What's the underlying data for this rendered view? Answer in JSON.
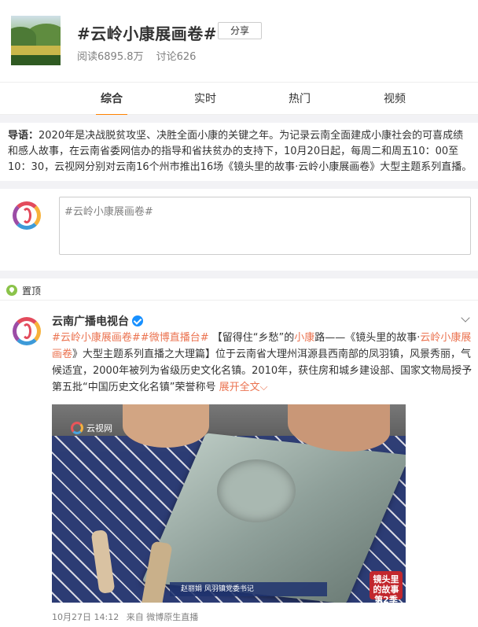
{
  "header": {
    "title": "#云岭小康展画卷#",
    "share_label": "分享",
    "reads": "阅读6895.8万",
    "discussions": "讨论626"
  },
  "tabs": [
    {
      "label": "综合",
      "active": true
    },
    {
      "label": "实时",
      "active": false
    },
    {
      "label": "热门",
      "active": false
    },
    {
      "label": "视频",
      "active": false
    }
  ],
  "intro": {
    "prefix": "导语：",
    "text": "2020年是决战脱贫攻坚、决胜全面小康的关键之年。为记录云南全面建成小康社会的可喜成绩和感人故事，在云南省委网信办的指导和省扶贫办的支持下，10月20日起，每周二和周五10：00至10：30，云视网分别对云南16个州市推出16场《镜头里的故事·云岭小康展画卷》大型主题系列直播。"
  },
  "composer": {
    "placeholder_text": "#云岭小康展画卷#"
  },
  "pinned": {
    "label": "置顶"
  },
  "post": {
    "author": "云南广播电视台",
    "tag1": "#云岭小康展画卷#",
    "tag2": "#微博直播台#",
    "text_part1": "【留得住“乡愁”的",
    "highlight1": "小康",
    "text_part2": "路——《镜头里的故事·",
    "highlight2": "云岭小康展画卷",
    "text_part3": "》大型主题系列直播之大理篇】位于云南省大理州洱源县西南部的凤羽镇，风景秀丽，气候适宜，2000年被列为省级历史文化名镇。2010年，获住房和城乡建设部、国家文物局授予第五批“中国历史文化名镇”荣誉称号",
    "expand_label": "展开全文",
    "video": {
      "watermark": "云视网",
      "caption": "赵丽娟  风羽镇党委书记",
      "badge_line1": "镜头里",
      "badge_line2": "的故事",
      "badge_line3": "第2季"
    },
    "date": "10月27日 14:12",
    "source": "来自 微博原生直播"
  },
  "colors": {
    "accent": "#ff8200",
    "link": "#eb7350",
    "muted": "#808080"
  }
}
